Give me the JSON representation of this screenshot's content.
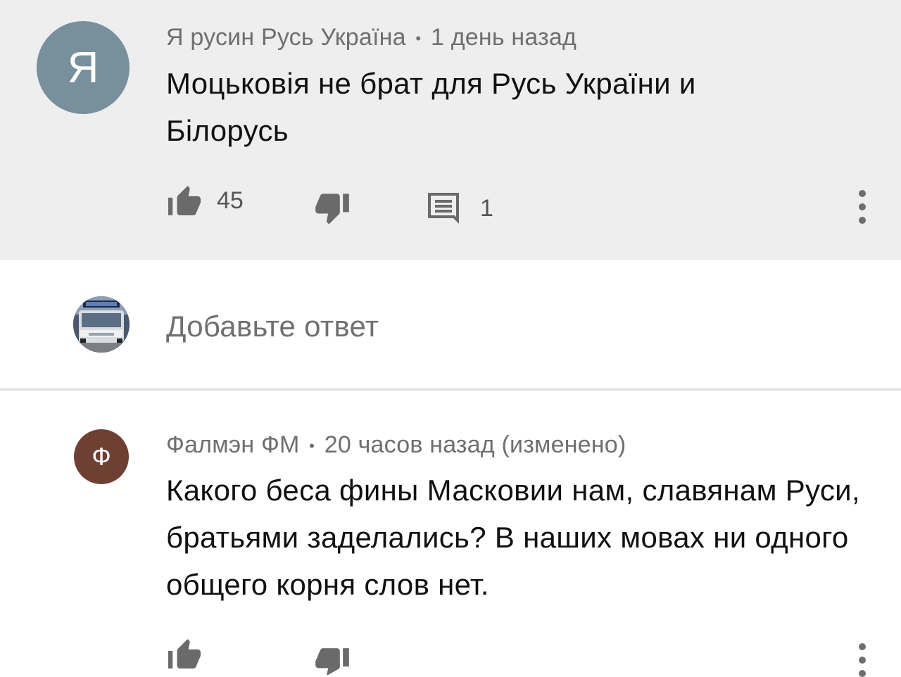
{
  "comments": [
    {
      "avatar_letter": "Я",
      "avatar_color": "#78909c",
      "author": "Я русин Русь Україна",
      "separator": "•",
      "time": "1 день назад",
      "text": "Моцьковія не брат для Русь України и Білорусь",
      "likes": "45",
      "replies": "1"
    },
    {
      "avatar_letter": "Ф",
      "avatar_color": "#6d4033",
      "author": "Фалмэн ФМ",
      "separator": "•",
      "time": "20 часов назад (изменено)",
      "text": "Какого беса фины Масковии нам, славянам Руси, братьями заделались? В наших мовах ни одного общего корня слов нет."
    }
  ],
  "reply_box": {
    "placeholder": "Добавьте ответ",
    "avatar_icon": "bus-photo-avatar"
  },
  "icons": {
    "like": "thumbs-up-icon",
    "dislike": "thumbs-down-icon",
    "reply": "comment-icon",
    "more": "more-vert-icon"
  }
}
